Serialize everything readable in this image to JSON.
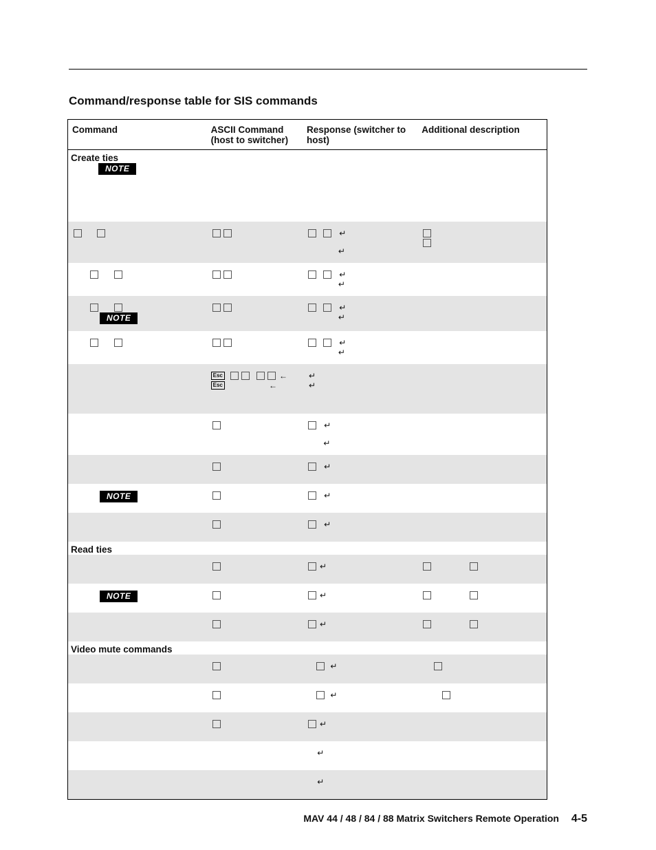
{
  "section_title": "Command/response table for SIS commands",
  "columns": {
    "cmd": "Command",
    "ascii": "ASCII Command",
    "ascii_sub": "(host to switcher)",
    "resp": "Response",
    "resp_sub": "(switcher to host)",
    "desc": "Additional description"
  },
  "groups": {
    "create": "Create ties",
    "read": "Read ties",
    "mute": "Video mute commands"
  },
  "note_label": "NOTE",
  "esc_label": "Esc",
  "footer": {
    "book": "MAV 44 / 48 / 84 / 88 Matrix Switchers   Remote Operation",
    "page": "4-5"
  }
}
